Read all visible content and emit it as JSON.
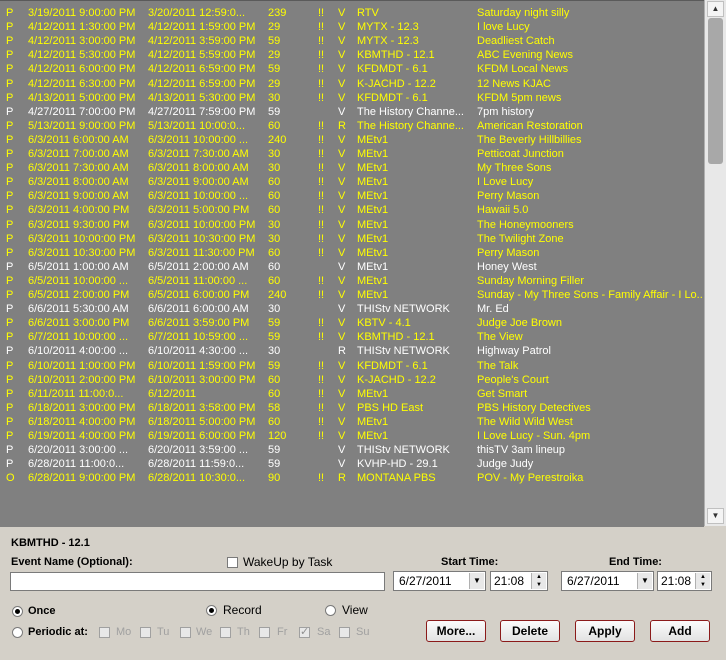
{
  "recordings": [
    {
      "flag": "P",
      "start": "3/19/2011 9:00:00 PM",
      "end": "3/20/2011 12:59:0...",
      "dur": "239",
      "pri": "!!",
      "mode": "V",
      "channel": "RTV",
      "title": "Saturday night silly",
      "color": "yellow"
    },
    {
      "flag": "P",
      "start": "4/12/2011 1:30:00 PM",
      "end": "4/12/2011 1:59:00 PM",
      "dur": "29",
      "pri": "!!",
      "mode": "V",
      "channel": "MYTX - 12.3",
      "title": "I love Lucy",
      "color": "yellow"
    },
    {
      "flag": "P",
      "start": "4/12/2011 3:00:00 PM",
      "end": "4/12/2011 3:59:00 PM",
      "dur": "59",
      "pri": "!!",
      "mode": "V",
      "channel": "MYTX - 12.3",
      "title": "Deadliest Catch",
      "color": "yellow"
    },
    {
      "flag": "P",
      "start": "4/12/2011 5:30:00 PM",
      "end": "4/12/2011 5:59:00 PM",
      "dur": "29",
      "pri": "!!",
      "mode": "V",
      "channel": "KBMTHD - 12.1",
      "title": "ABC Evening News",
      "color": "yellow"
    },
    {
      "flag": "P",
      "start": "4/12/2011 6:00:00 PM",
      "end": "4/12/2011 6:59:00 PM",
      "dur": "59",
      "pri": "!!",
      "mode": "V",
      "channel": "KFDMDT - 6.1",
      "title": "KFDM Local News",
      "color": "yellow"
    },
    {
      "flag": "P",
      "start": "4/12/2011 6:30:00 PM",
      "end": "4/12/2011 6:59:00 PM",
      "dur": "29",
      "pri": "!!",
      "mode": "V",
      "channel": "K-JACHD - 12.2",
      "title": "12 News KJAC",
      "color": "yellow"
    },
    {
      "flag": "P",
      "start": "4/13/2011 5:00:00 PM",
      "end": "4/13/2011 5:30:00 PM",
      "dur": "30",
      "pri": "!!",
      "mode": "V",
      "channel": "KFDMDT - 6.1",
      "title": "KFDM 5pm news",
      "color": "yellow"
    },
    {
      "flag": "P",
      "start": "4/27/2011 7:00:00 PM",
      "end": "4/27/2011 7:59:00 PM",
      "dur": "59",
      "pri": "",
      "mode": "V",
      "channel": "The History Channe...",
      "title": "7pm history",
      "color": "white"
    },
    {
      "flag": "P",
      "start": "5/13/2011 9:00:00 PM",
      "end": "5/13/2011 10:00:0...",
      "dur": "60",
      "pri": "!!",
      "mode": "R",
      "channel": "The History Channe...",
      "title": "American Restoration",
      "color": "yellow"
    },
    {
      "flag": "P",
      "start": "6/3/2011 6:00:00 AM",
      "end": "6/3/2011 10:00:00 ...",
      "dur": "240",
      "pri": "!!",
      "mode": "V",
      "channel": "MEtv1",
      "title": "The Beverly Hillbillies",
      "color": "yellow"
    },
    {
      "flag": "P",
      "start": "6/3/2011 7:00:00 AM",
      "end": "6/3/2011 7:30:00 AM",
      "dur": "30",
      "pri": "!!",
      "mode": "V",
      "channel": "MEtv1",
      "title": "Petticoat Junction",
      "color": "yellow"
    },
    {
      "flag": "P",
      "start": "6/3/2011 7:30:00 AM",
      "end": "6/3/2011 8:00:00 AM",
      "dur": "30",
      "pri": "!!",
      "mode": "V",
      "channel": "MEtv1",
      "title": "My Three Sons",
      "color": "yellow"
    },
    {
      "flag": "P",
      "start": "6/3/2011 8:00:00 AM",
      "end": "6/3/2011 9:00:00 AM",
      "dur": "60",
      "pri": "!!",
      "mode": "V",
      "channel": "MEtv1",
      "title": "I Love Lucy",
      "color": "yellow"
    },
    {
      "flag": "P",
      "start": "6/3/2011 9:00:00 AM",
      "end": "6/3/2011 10:00:00 ...",
      "dur": "60",
      "pri": "!!",
      "mode": "V",
      "channel": "MEtv1",
      "title": "Perry Mason",
      "color": "yellow"
    },
    {
      "flag": "P",
      "start": "6/3/2011 4:00:00 PM",
      "end": "6/3/2011 5:00:00 PM",
      "dur": "60",
      "pri": "!!",
      "mode": "V",
      "channel": "MEtv1",
      "title": "Hawaii 5.0",
      "color": "yellow"
    },
    {
      "flag": "P",
      "start": "6/3/2011 9:30:00 PM",
      "end": "6/3/2011 10:00:00 PM",
      "dur": "30",
      "pri": "!!",
      "mode": "V",
      "channel": "MEtv1",
      "title": "The Honeymooners",
      "color": "yellow"
    },
    {
      "flag": "P",
      "start": "6/3/2011 10:00:00 PM",
      "end": "6/3/2011 10:30:00 PM",
      "dur": "30",
      "pri": "!!",
      "mode": "V",
      "channel": "MEtv1",
      "title": "The Twilight Zone",
      "color": "yellow"
    },
    {
      "flag": "P",
      "start": "6/3/2011 10:30:00 PM",
      "end": "6/3/2011 11:30:00 PM",
      "dur": "60",
      "pri": "!!",
      "mode": "V",
      "channel": "MEtv1",
      "title": "Perry Mason",
      "color": "yellow"
    },
    {
      "flag": "P",
      "start": "6/5/2011 1:00:00 AM",
      "end": "6/5/2011 2:00:00 AM",
      "dur": "60",
      "pri": "",
      "mode": "V",
      "channel": "MEtv1",
      "title": "Honey West",
      "color": "white"
    },
    {
      "flag": "P",
      "start": "6/5/2011 10:00:00 ...",
      "end": "6/5/2011 11:00:00 ...",
      "dur": "60",
      "pri": "!!",
      "mode": "V",
      "channel": "MEtv1",
      "title": "Sunday Morning Filler",
      "color": "yellow"
    },
    {
      "flag": "P",
      "start": "6/5/2011 2:00:00 PM",
      "end": "6/5/2011 6:00:00 PM",
      "dur": "240",
      "pri": "!!",
      "mode": "V",
      "channel": "MEtv1",
      "title": "Sunday - My Three Sons - Family Affair - I Lo...",
      "color": "yellow"
    },
    {
      "flag": "P",
      "start": "6/6/2011 5:30:00 AM",
      "end": "6/6/2011 6:00:00 AM",
      "dur": "30",
      "pri": "",
      "mode": "V",
      "channel": "THIStv NETWORK",
      "title": "Mr. Ed",
      "color": "white"
    },
    {
      "flag": "P",
      "start": "6/6/2011 3:00:00 PM",
      "end": "6/6/2011 3:59:00 PM",
      "dur": "59",
      "pri": "!!",
      "mode": "V",
      "channel": "KBTV - 4.1",
      "title": "Judge Joe Brown",
      "color": "yellow"
    },
    {
      "flag": "P",
      "start": "6/7/2011 10:00:00 ...",
      "end": "6/7/2011 10:59:00 ...",
      "dur": "59",
      "pri": "!!",
      "mode": "V",
      "channel": "KBMTHD - 12.1",
      "title": "The View",
      "color": "yellow"
    },
    {
      "flag": "P",
      "start": "6/10/2011 4:00:00 ...",
      "end": "6/10/2011 4:30:00 ...",
      "dur": "30",
      "pri": "",
      "mode": "R",
      "channel": "THIStv NETWORK",
      "title": "Highway Patrol",
      "color": "white"
    },
    {
      "flag": "P",
      "start": "6/10/2011 1:00:00 PM",
      "end": "6/10/2011 1:59:00 PM",
      "dur": "59",
      "pri": "!!",
      "mode": "V",
      "channel": "KFDMDT - 6.1",
      "title": "The Talk",
      "color": "yellow"
    },
    {
      "flag": "P",
      "start": "6/10/2011 2:00:00 PM",
      "end": "6/10/2011 3:00:00 PM",
      "dur": "60",
      "pri": "!!",
      "mode": "V",
      "channel": "K-JACHD - 12.2",
      "title": "People's Court",
      "color": "yellow"
    },
    {
      "flag": "P",
      "start": "6/11/2011 11:00:0...",
      "end": "6/12/2011",
      "dur": "60",
      "pri": "!!",
      "mode": "V",
      "channel": "MEtv1",
      "title": "Get Smart",
      "color": "yellow"
    },
    {
      "flag": "P",
      "start": "6/18/2011 3:00:00 PM",
      "end": "6/18/2011 3:58:00 PM",
      "dur": "58",
      "pri": "!!",
      "mode": "V",
      "channel": "PBS HD East",
      "title": "PBS History Detectives",
      "color": "yellow"
    },
    {
      "flag": "P",
      "start": "6/18/2011 4:00:00 PM",
      "end": "6/18/2011 5:00:00 PM",
      "dur": "60",
      "pri": "!!",
      "mode": "V",
      "channel": "MEtv1",
      "title": "The Wild Wild West",
      "color": "yellow"
    },
    {
      "flag": "P",
      "start": "6/19/2011 4:00:00 PM",
      "end": "6/19/2011 6:00:00 PM",
      "dur": "120",
      "pri": "!!",
      "mode": "V",
      "channel": "MEtv1",
      "title": "I Love Lucy - Sun. 4pm",
      "color": "yellow"
    },
    {
      "flag": "P",
      "start": "6/20/2011 3:00:00 ...",
      "end": "6/20/2011 3:59:00 ...",
      "dur": "59",
      "pri": "",
      "mode": "V",
      "channel": "THIStv NETWORK",
      "title": "thisTV 3am lineup",
      "color": "white"
    },
    {
      "flag": "P",
      "start": "6/28/2011 11:00:0...",
      "end": "6/28/2011 11:59:0...",
      "dur": "59",
      "pri": "",
      "mode": "V",
      "channel": "KVHP-HD - 29.1",
      "title": "Judge Judy",
      "color": "white"
    },
    {
      "flag": "O",
      "start": "6/28/2011 9:00:00 PM",
      "end": "6/28/2011 10:30:0...",
      "dur": "90",
      "pri": "!!",
      "mode": "R",
      "channel": "MONTANA PBS",
      "title": "POV - My Perestroika",
      "color": "yellow"
    }
  ],
  "colors": {
    "yellow": "#ffff00",
    "white": "#ffffff",
    "list_bg": "#808080",
    "button_border": "#8b1a1a"
  },
  "form": {
    "channel_label": "KBMTHD - 12.1",
    "event_name_label": "Event Name (Optional):",
    "event_name_value": "",
    "wakeup_label": "WakeUp by Task",
    "start_time_label": "Start Time:",
    "end_time_label": "End Time:",
    "start_date": "6/27/2011",
    "start_time": "21:08",
    "end_date": "6/27/2011",
    "end_time": "21:08",
    "once_label": "Once",
    "periodic_label": "Periodic at:",
    "days": [
      "Mo",
      "Tu",
      "We",
      "Th",
      "Fr",
      "Sa",
      "Su"
    ],
    "record_label": "Record",
    "view_label": "View",
    "buttons": {
      "more": "More...",
      "delete": "Delete",
      "apply": "Apply",
      "add": "Add"
    }
  }
}
